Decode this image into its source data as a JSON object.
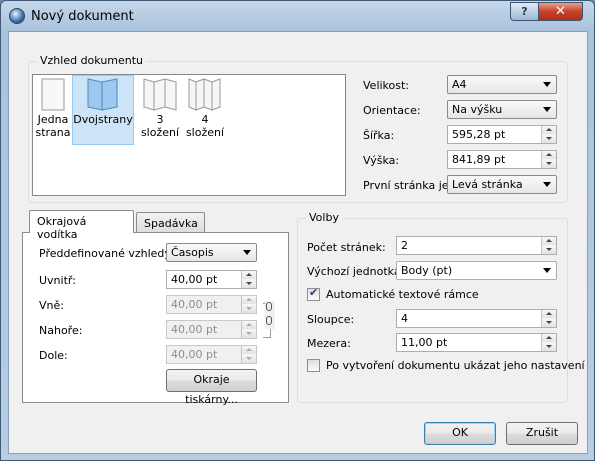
{
  "window": {
    "title": "Nový dokument",
    "help_label": "?",
    "close_label": "✕"
  },
  "appearance": {
    "group_title": "Vzhled dokumentu",
    "layouts": [
      {
        "label": "Jedna strana",
        "icon": "single-page-icon",
        "selected": false
      },
      {
        "label": "Dvojstrany",
        "icon": "double-page-icon",
        "selected": true
      },
      {
        "label": "3 složení",
        "icon": "three-fold-icon",
        "selected": false
      },
      {
        "label": "4 složení",
        "icon": "four-fold-icon",
        "selected": false
      }
    ],
    "size_label": "Velikost:",
    "size_value": "A4",
    "orientation_label": "Orientace:",
    "orientation_value": "Na výšku",
    "width_label": "Šířka:",
    "width_value": "595,28 pt",
    "height_label": "Výška:",
    "height_value": "841,89 pt",
    "first_page_label": "První stránka je:",
    "first_page_value": "Levá stránka"
  },
  "tabs": {
    "margins": "Okrajová vodítka",
    "bleed": "Spadávka"
  },
  "margins": {
    "preset_label": "Předdefinované vzhledy:",
    "preset_value": "Časopis",
    "inside_label": "Uvnitř:",
    "inside_value": "40,00 pt",
    "outside_label": "Vně:",
    "outside_value": "40,00 pt",
    "top_label": "Nahoře:",
    "top_value": "40,00 pt",
    "bottom_label": "Dole:",
    "bottom_value": "40,00 pt",
    "printer_margins_button": "Okraje tiskárny..."
  },
  "options": {
    "group_title": "Volby",
    "pages_label": "Počet stránek:",
    "pages_value": "2",
    "unit_label": "Výchozí jednotka:",
    "unit_value": "Body (pt)",
    "auto_frames_label": "Automatické textové rámce",
    "auto_frames_checked": true,
    "columns_label": "Sloupce:",
    "columns_value": "4",
    "gap_label": "Mezera:",
    "gap_value": "11,00 pt",
    "show_settings_label": "Po vytvoření dokumentu ukázat jeho nastavení",
    "show_settings_checked": false
  },
  "buttons": {
    "ok": "OK",
    "cancel": "Zrušit"
  }
}
